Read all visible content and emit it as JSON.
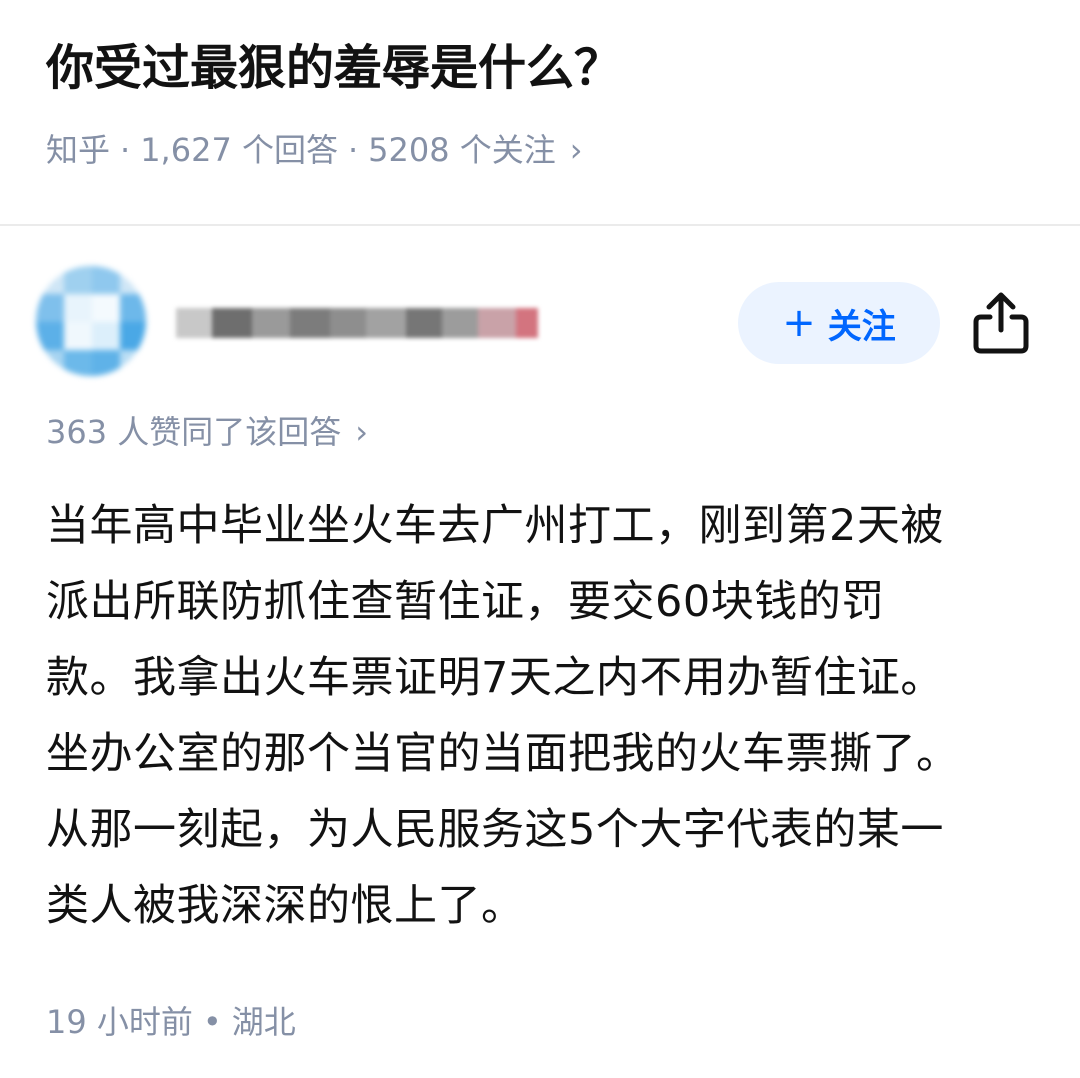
{
  "question": {
    "title": "你受过最狠的羞辱是什么？",
    "source": "知乎",
    "answers": "1,627 个回答",
    "followers": "5208 个关注",
    "separator": "·",
    "chevron": "›"
  },
  "author": {
    "avatar_icon": "avatar-blurred",
    "follow_plus": "+",
    "follow_label": "关注",
    "share_icon": "share-icon"
  },
  "answer": {
    "votes": "363 人赞同了该回答",
    "votes_chevron": "›",
    "lines": [
      "当年高中毕业坐火车去广州打工，刚到第2天被",
      "派出所联防抓住查暂住证，要交60块钱的罚",
      "款。我拿出火车票证明7天之内不用办暂住证。",
      "坐办公室的那个当官的当面把我的火车票撕了。",
      "从那一刻起，为人民服务这5个大字代表的某一",
      "类人被我深深的恨上了。"
    ],
    "time": "19 小时前",
    "dot": "•",
    "location": "湖北"
  },
  "colors": {
    "accent": "#0066ff",
    "accent_bg": "#ebf3ff",
    "meta_gray": "#8590a6",
    "text": "#121212",
    "divider": "#ebebeb"
  }
}
